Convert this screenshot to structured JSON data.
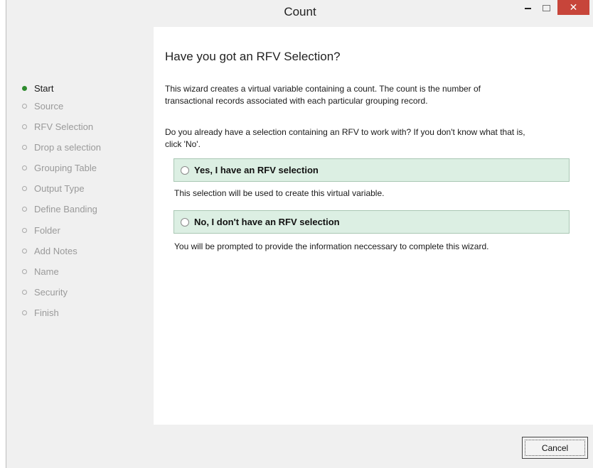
{
  "window": {
    "title": "Count",
    "minimize_icon": "minimize-icon",
    "maximize_icon": "maximize-icon",
    "close_icon": "close-icon",
    "close_glyph": "✕",
    "close_color": "#c7453a"
  },
  "steps": [
    {
      "label": "Start",
      "active": true
    },
    {
      "label": "Source",
      "active": false
    },
    {
      "label": "RFV Selection",
      "active": false
    },
    {
      "label": "Drop a selection",
      "active": false
    },
    {
      "label": "Grouping Table",
      "active": false
    },
    {
      "label": "Output Type",
      "active": false
    },
    {
      "label": "Define Banding",
      "active": false
    },
    {
      "label": "Folder",
      "active": false
    },
    {
      "label": "Add Notes",
      "active": false
    },
    {
      "label": "Name",
      "active": false
    },
    {
      "label": "Security",
      "active": false
    },
    {
      "label": "Finish",
      "active": false
    }
  ],
  "colors": {
    "active_step": "#2e8b2e",
    "option_bg": "#dcefe3"
  },
  "main": {
    "heading": "Have you got an RFV Selection?",
    "intro_line1": "This wizard creates a virtual variable containing a count. The count is the number of",
    "intro_line2": "transactional records associated with each particular grouping record.",
    "question_line1": "Do you already have a selection containing an RFV to work with? If you don't know what that is,",
    "question_line2": "click 'No'.",
    "option_yes": {
      "label": "Yes, I have an RFV selection",
      "note": "This selection will be used to create this virtual variable.",
      "selected": false
    },
    "option_no": {
      "label": "No, I don't have an RFV selection",
      "note": "You will be prompted to provide the information neccessary to complete this wizard.",
      "selected": false
    }
  },
  "footer": {
    "cancel_label": "Cancel"
  }
}
